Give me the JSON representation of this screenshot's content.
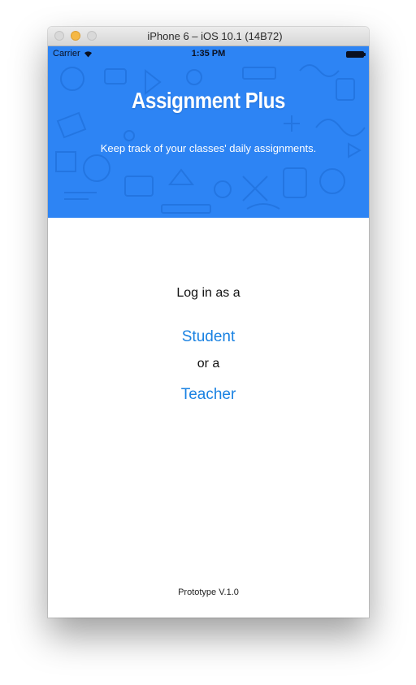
{
  "window": {
    "title": "iPhone 6 – iOS 10.1 (14B72)"
  },
  "status_bar": {
    "carrier": "Carrier",
    "time": "1:35 PM",
    "icons": [
      "wifi-icon",
      "battery-icon"
    ]
  },
  "hero": {
    "title": "Assignment Plus",
    "subtitle": "Keep track of your classes' daily assignments.",
    "background_color": "#2d84f4"
  },
  "login": {
    "prompt": "Log in as a",
    "student_label": "Student",
    "or_label": "or a",
    "teacher_label": "Teacher",
    "link_color": "#1a82e2"
  },
  "footer": {
    "version": "Prototype V.1.0"
  }
}
